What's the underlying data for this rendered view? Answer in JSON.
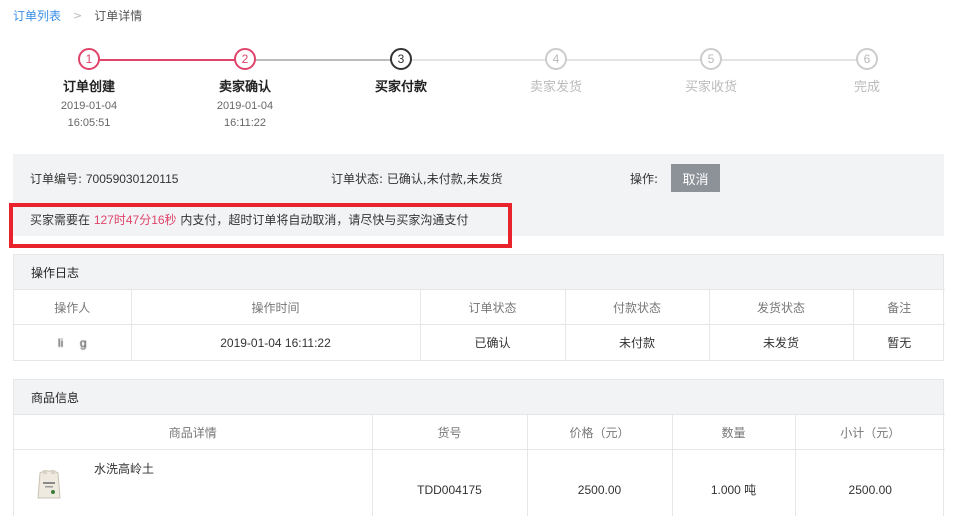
{
  "breadcrumb": {
    "parent": "订单列表",
    "separator": ">",
    "current": "订单详情"
  },
  "steps": [
    {
      "num": "1",
      "label": "订单创建",
      "date": "2019-01-04",
      "time": "16:05:51",
      "state": "done"
    },
    {
      "num": "2",
      "label": "卖家确认",
      "date": "2019-01-04",
      "time": "16:11:22",
      "state": "done"
    },
    {
      "num": "3",
      "label": "买家付款",
      "date": "",
      "time": "",
      "state": "current"
    },
    {
      "num": "4",
      "label": "卖家发货",
      "date": "",
      "time": "",
      "state": "todo"
    },
    {
      "num": "5",
      "label": "买家收货",
      "date": "",
      "time": "",
      "state": "todo"
    },
    {
      "num": "6",
      "label": "完成",
      "date": "",
      "time": "",
      "state": "todo"
    }
  ],
  "colors": {
    "done": "#e0446a",
    "current": "#333333",
    "todo": "#cccccc",
    "highlight_box": "#e8232b",
    "link": "#3a8ee6"
  },
  "order": {
    "no_label": "订单编号:",
    "no_value": "70059030120115",
    "status_label": "订单状态:",
    "status_value": "已确认,未付款,未发货",
    "op_label": "操作:",
    "cancel_label": "取消",
    "notice_prefix": "买家需要在 ",
    "notice_countdown": "127时47分16秒",
    "notice_suffix": " 内支付，超时订单将自动取消，请尽快与买家沟通支付"
  },
  "log": {
    "title": "操作日志",
    "headers": [
      "操作人",
      "操作时间",
      "订单状态",
      "付款状态",
      "发货状态",
      "备注"
    ],
    "rows": [
      {
        "operator": "li     g",
        "time": "2019-01-04 16:11:22",
        "order_status": "已确认",
        "pay_status": "未付款",
        "ship_status": "未发货",
        "note": "暂无"
      }
    ]
  },
  "goods": {
    "title": "商品信息",
    "headers": [
      "商品详情",
      "货号",
      "价格（元）",
      "数量",
      "小计（元）"
    ],
    "rows": [
      {
        "icon": "product-bag-icon",
        "name": "水洗高岭土",
        "sku": "TDD004175",
        "price": "2500.00",
        "qty": "1.000 吨",
        "subtotal": "2500.00"
      }
    ]
  }
}
